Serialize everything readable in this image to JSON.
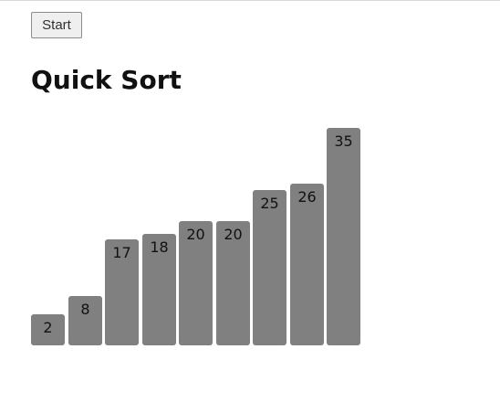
{
  "controls": {
    "start_label": "Start"
  },
  "header": {
    "title": "Quick Sort"
  },
  "colors": {
    "bar": "#808080",
    "label": "#111111"
  },
  "chart_data": {
    "type": "bar",
    "values": [
      2,
      8,
      17,
      18,
      20,
      20,
      25,
      26,
      35
    ]
  }
}
